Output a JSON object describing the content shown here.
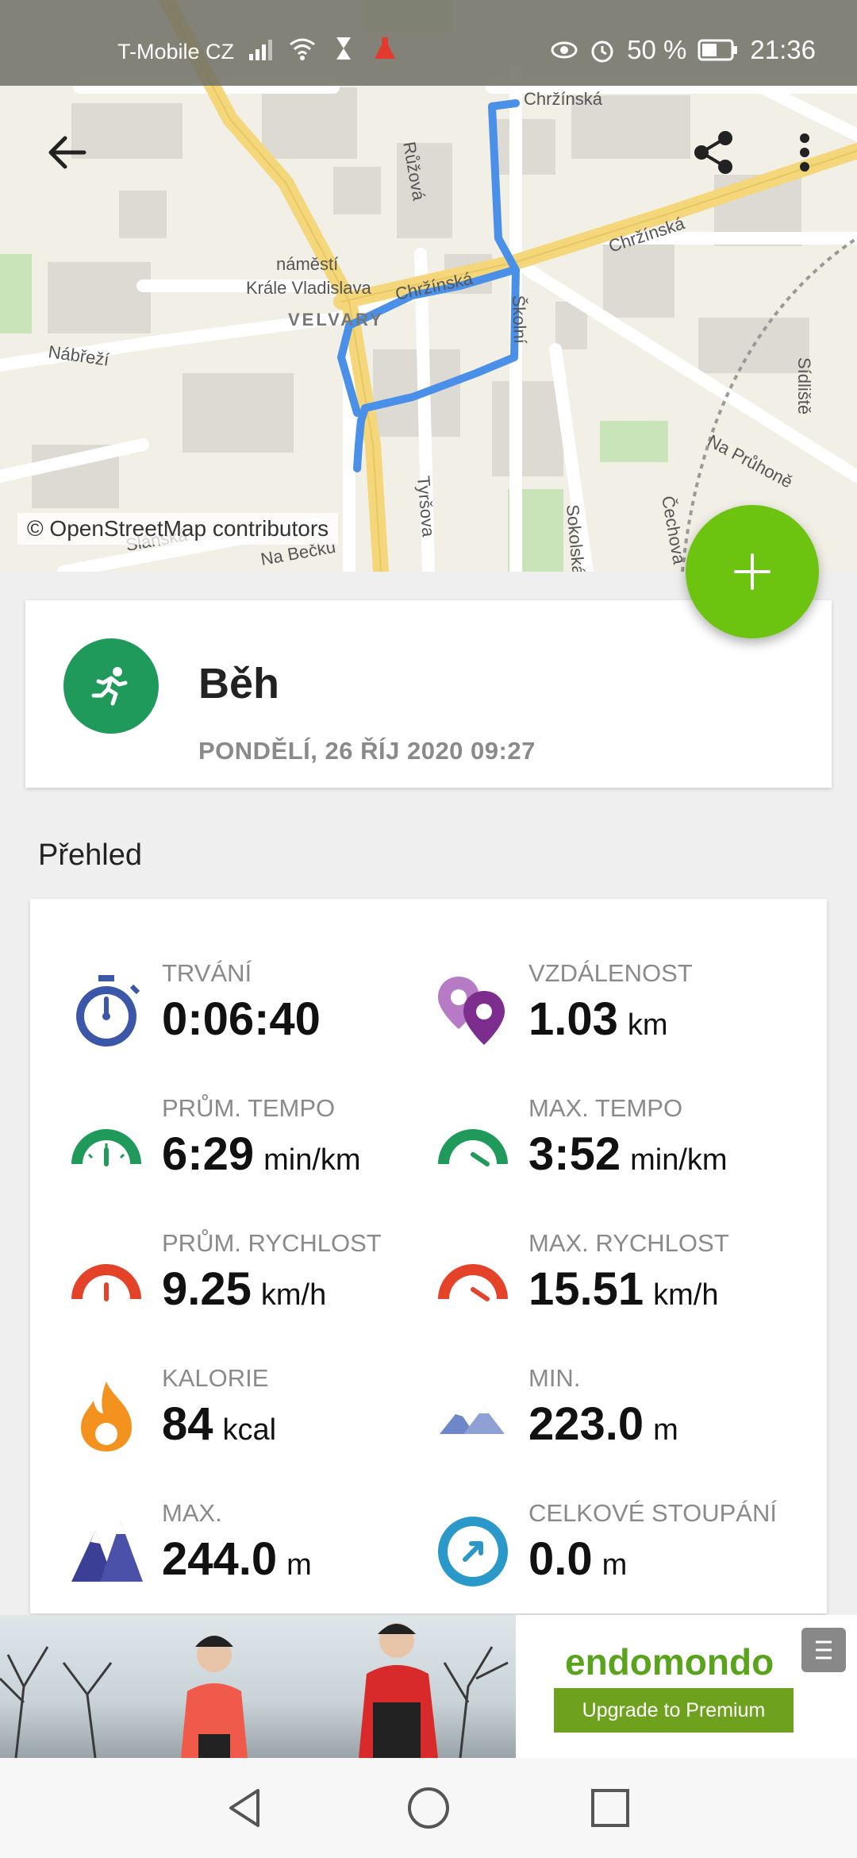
{
  "status_bar": {
    "carrier": "T-Mobile CZ",
    "battery": "50 %",
    "time": "21:36"
  },
  "map": {
    "attribution": "© OpenStreetMap contributors",
    "labels": {
      "square_1": "náměstí",
      "square_2": "Krále Vladislava",
      "district": "VELVARY",
      "street_chrzinska": "Chržínská",
      "street_chrzinska_2": "Chržínská",
      "street_chrzinska_top": "Chržínská",
      "street_ruzova": "Růžová",
      "street_nabrezi": "Nábřeží",
      "street_tyrsova": "Tyršova",
      "street_sokolska": "Sokolská",
      "street_na_pruhone": "Na Průhoně",
      "street_slanska": "Slánská",
      "street_sidliste": "Sídliště",
      "street_cechova": "Čechova",
      "street_skolni": "Školní",
      "street_na_becku": "Na Bečku"
    }
  },
  "activity": {
    "title": "Běh",
    "date": "PONDĚLÍ, 26 ŘÍJ 2020 09:27"
  },
  "overview": {
    "section_title": "Přehled",
    "stats": [
      {
        "label": "TRVÁNÍ",
        "value": "0:06:40",
        "unit": "",
        "icon": "stopwatch-icon"
      },
      {
        "label": "VZDÁLENOST",
        "value": "1.03",
        "unit": "km",
        "icon": "map-pins-icon"
      },
      {
        "label": "PRŮM. TEMPO",
        "value": "6:29",
        "unit": "min/km",
        "icon": "gauge-green-icon"
      },
      {
        "label": "MAX. TEMPO",
        "value": "3:52",
        "unit": "min/km",
        "icon": "gauge-green-max-icon"
      },
      {
        "label": "PRŮM. RYCHLOST",
        "value": "9.25",
        "unit": "km/h",
        "icon": "gauge-red-icon"
      },
      {
        "label": "MAX. RYCHLOST",
        "value": "15.51",
        "unit": "km/h",
        "icon": "gauge-red-max-icon"
      },
      {
        "label": "KALORIE",
        "value": "84",
        "unit": "kcal",
        "icon": "flame-icon"
      },
      {
        "label": "MIN.",
        "value": "223.0",
        "unit": "m",
        "icon": "mountains-low-icon"
      },
      {
        "label": "MAX.",
        "value": "244.0",
        "unit": "m",
        "icon": "mountains-high-icon"
      },
      {
        "label": "CELKOVÉ STOUPÁNÍ",
        "value": "0.0",
        "unit": "m",
        "icon": "ascent-compass-icon"
      }
    ]
  },
  "ad": {
    "brand": "endomondo",
    "cta": "Upgrade to Premium"
  },
  "colors": {
    "fab": "#6cc310",
    "activity_icon_bg": "#1f9a5b",
    "route": "#4a90e8",
    "ad_button": "#6ea21e"
  }
}
